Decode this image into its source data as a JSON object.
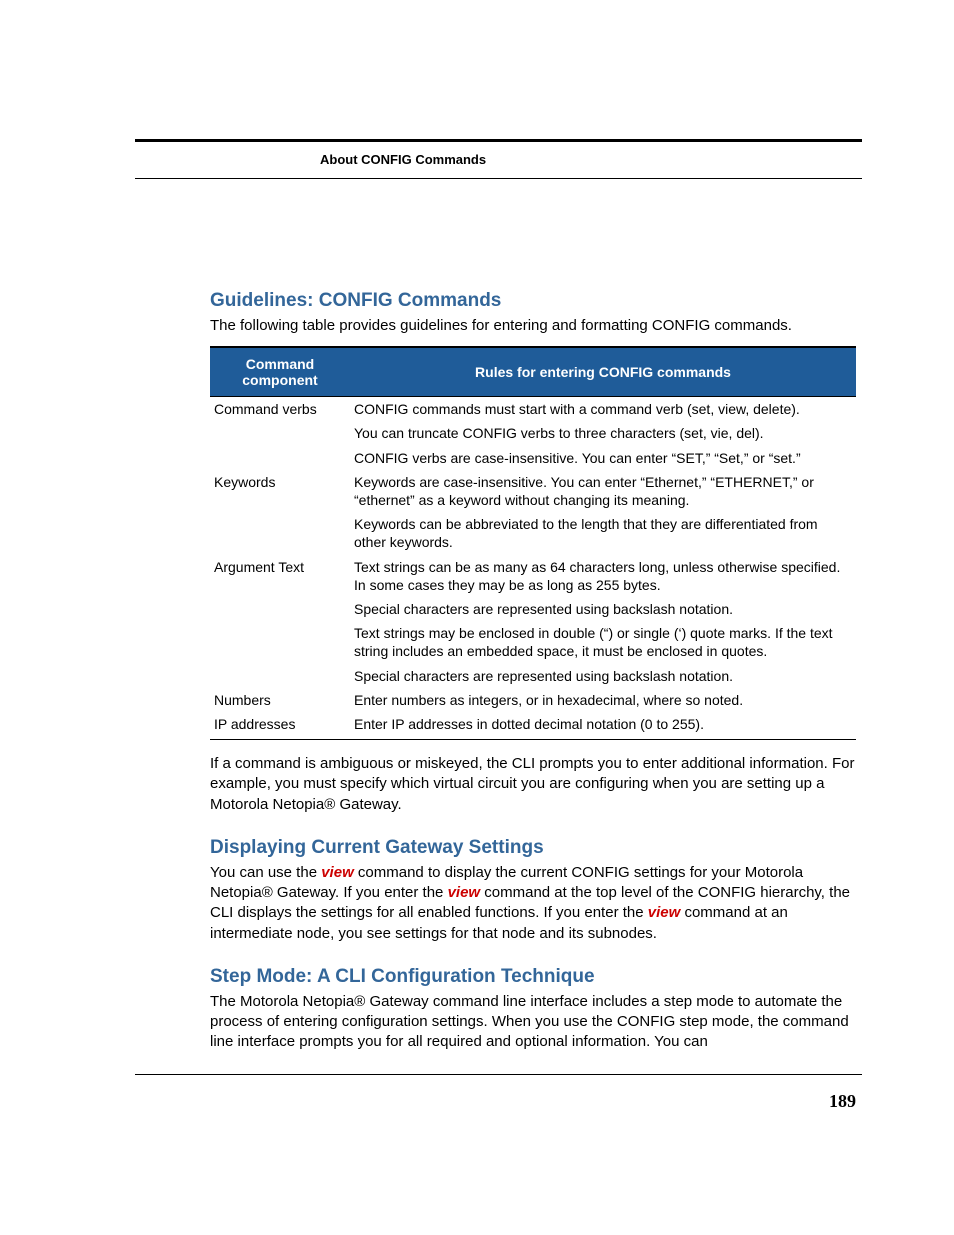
{
  "header": {
    "label": "About CONFIG Commands"
  },
  "section1": {
    "title": "Guidelines: CONFIG Commands",
    "intro": "The following table provides guidelines for entering and formatting CONFIG commands."
  },
  "table": {
    "head": {
      "col1": "Command component",
      "col2": "Rules for entering CONFIG commands"
    },
    "rows": [
      {
        "c1": "Command verbs",
        "c2": "CONFIG commands must start with a command verb (set, view, delete)."
      },
      {
        "c1": "",
        "c2": "You can truncate CONFIG verbs to three characters (set, vie, del)."
      },
      {
        "c1": "",
        "c2": "CONFIG verbs are case-insensitive. You can enter “SET,” “Set,” or “set.”"
      },
      {
        "c1": "Keywords",
        "c2": "Keywords are case-insensitive. You can enter “Ethernet,” “ETHERNET,” or “ethernet” as a keyword without changing its meaning."
      },
      {
        "c1": "",
        "c2": "Keywords can be abbreviated to the length that they are differentiated from other keywords."
      },
      {
        "c1": "Argument Text",
        "c2": "Text strings can be as many as 64 characters long, unless otherwise specified. In some cases they may be as long as 255 bytes."
      },
      {
        "c1": "",
        "c2": "Special characters are represented using backslash notation."
      },
      {
        "c1": "",
        "c2": "Text strings may be enclosed in double (“) or single (‘) quote marks. If the text string includes an embedded space, it must be enclosed in quotes."
      },
      {
        "c1": "",
        "c2": "Special characters are represented using backslash notation."
      },
      {
        "c1": "Numbers",
        "c2": "Enter numbers as integers, or in hexadecimal, where so noted."
      },
      {
        "c1": "IP addresses",
        "c2": "Enter IP addresses in dotted decimal notation (0 to 255)."
      }
    ]
  },
  "post_table": "If a command is ambiguous or miskeyed, the CLI prompts you to enter additional information. For example, you must specify which virtual circuit you are configuring when you are setting up a Motorola Netopia® Gateway.",
  "section2": {
    "title": "Displaying Current Gateway Settings",
    "p1a": "You can use the ",
    "p1b": " command to display the current CONFIG settings for your Motorola Netopia® Gateway. If you enter the ",
    "p1c": "  command at the top level of the CONFIG hierarchy, the CLI displays the settings for all enabled functions. If you enter the ",
    "p1d": " command at an intermediate node, you see settings for that node and its subnodes.",
    "cmd": "view"
  },
  "section3": {
    "title": "Step Mode: A CLI Configuration Technique",
    "p": "The Motorola Netopia® Gateway command line interface includes a step mode to automate the process of entering configuration settings. When you use the CONFIG step mode, the command line interface prompts you for all required and optional information. You can"
  },
  "page_number": "189"
}
